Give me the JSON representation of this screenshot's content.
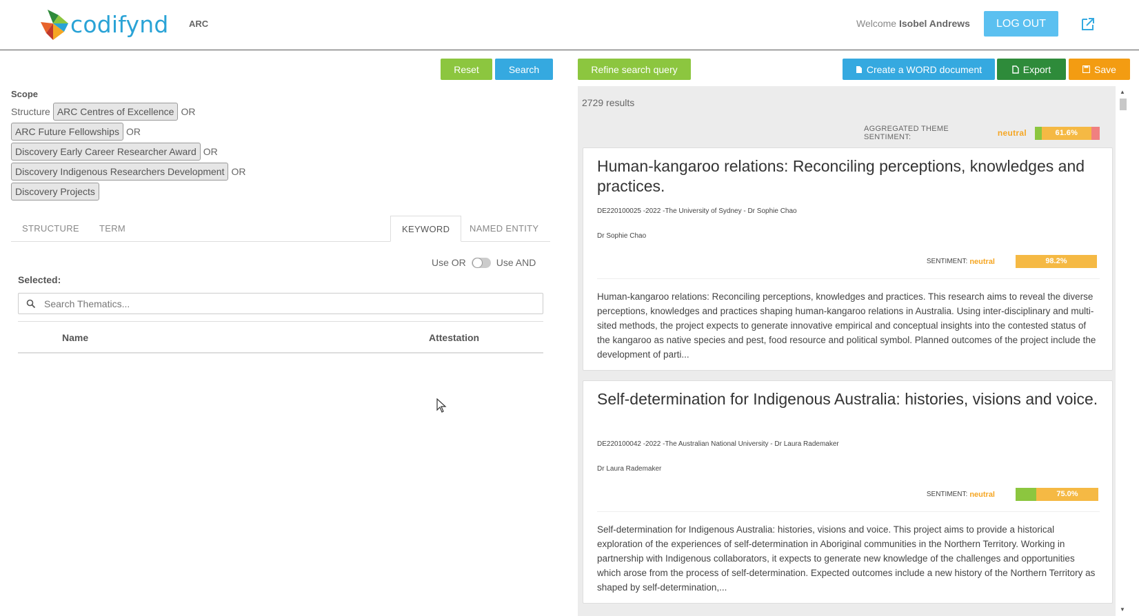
{
  "header": {
    "logo_text": "codifynd",
    "app_code": "ARC",
    "welcome_prefix": "Welcome",
    "user_name": "Isobel Andrews",
    "logout_label": "LOG OUT",
    "ext_icon": "external-link-icon"
  },
  "left": {
    "reset_label": "Reset",
    "search_label": "Search",
    "scope_title": "Scope",
    "structure_label": "Structure",
    "scope_items": [
      "ARC Centres of Excellence",
      "ARC Future Fellowships",
      "Discovery Early Career Researcher Award",
      "Discovery Indigenous Researchers Development",
      "Discovery Projects"
    ],
    "or_label": "OR",
    "tabs": [
      "STRUCTURE",
      "TERM",
      "KEYWORD",
      "NAMED ENTITY"
    ],
    "active_tab": "KEYWORD",
    "use_or": "Use OR",
    "use_and": "Use AND",
    "selected_label": "Selected:",
    "search_placeholder": "Search Thematics...",
    "col_name": "Name",
    "col_attestation": "Attestation"
  },
  "right": {
    "refine_label": "Refine search query",
    "word_label": "Create a WORD document",
    "export_label": "Export",
    "save_label": "Save",
    "results_count": "2729 results",
    "agg_label": "AGGREGATED THEME SENTIMENT:",
    "agg_value": "neutral",
    "agg_bar": {
      "positive": 0.084,
      "neutral": 0.616,
      "negative": 0.1,
      "label": "61.6%"
    },
    "colors": {
      "positive": "#8cc63f",
      "neutral": "#f5b944",
      "negative": "#f08080"
    },
    "results": [
      {
        "title": "Human-kangaroo relations: Reconciling perceptions, knowledges and practices.",
        "meta": "DE220100025 -2022 -The University of Sydney - Dr Sophie Chao",
        "person": "Dr Sophie Chao",
        "sentiment_label": "SENTIMENT:",
        "sentiment": "neutral",
        "bar_positive": 0.0,
        "bar_neutral": 0.982,
        "bar_label": "98.2%",
        "abstract": "Human-kangaroo relations: Reconciling perceptions, knowledges and practices. This research aims to reveal the diverse perceptions, knowledges and practices shaping human-kangaroo relations in Australia. Using inter-disciplinary and multi-sited methods, the project expects to generate innovative empirical and conceptual insights into the contested status of the kangaroo as native species and pest, food resource and political symbol. Planned outcomes of the project include the development of parti..."
      },
      {
        "title": "Self-determination for Indigenous Australia: histories, visions and voice.",
        "meta": "DE220100042 -2022 -The Australian National University - Dr Laura Rademaker",
        "person": "Dr Laura Rademaker",
        "sentiment_label": "SENTIMENT:",
        "sentiment": "neutral",
        "bar_positive": 0.25,
        "bar_neutral": 0.75,
        "bar_label": "75.0%",
        "abstract": "Self-determination for Indigenous Australia: histories, visions and voice. This project aims to provide a historical exploration of the experiences of self-determination in Aboriginal communities in the Northern Territory. Working in partnership with Indigenous collaborators, it expects to generate new knowledge of the challenges and opportunities which arose from the process of self-determination. Expected outcomes include a new history of the Northern Territory as shaped by self-determination,..."
      }
    ]
  }
}
